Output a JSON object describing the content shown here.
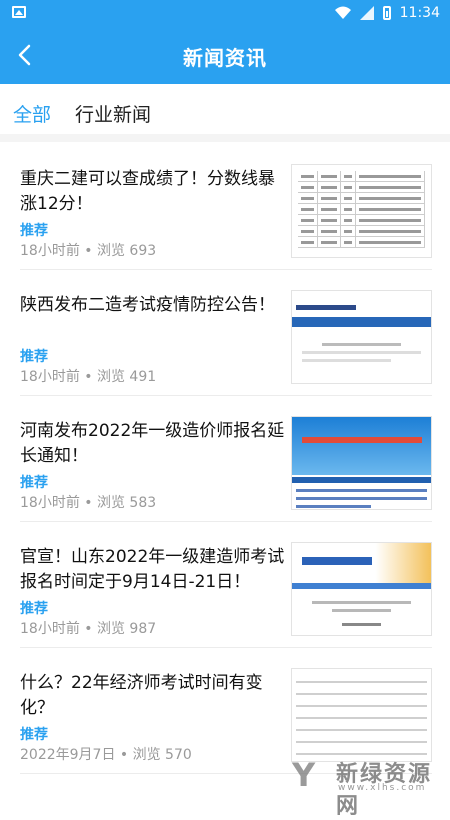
{
  "status_bar": {
    "time": "11:34"
  },
  "header": {
    "title": "新闻资讯"
  },
  "tabs": [
    {
      "label": "全部",
      "active": true
    },
    {
      "label": "行业新闻",
      "active": false
    }
  ],
  "articles": [
    {
      "title": "重庆二建可以查成绩了！分数线暴涨12分！",
      "tag": "推荐",
      "meta": "18小时前 • 浏览 693"
    },
    {
      "title": "陕西发布二造考试疫情防控公告！",
      "tag": "推荐",
      "meta": "18小时前 • 浏览 491"
    },
    {
      "title": "河南发布2022年一级造价师报名延长通知！",
      "tag": "推荐",
      "meta": "18小时前 • 浏览 583"
    },
    {
      "title": "官宣！山东2022年一级建造师考试报名时间定于9月14日-21日！",
      "tag": "推荐",
      "meta": "18小时前 • 浏览 987"
    },
    {
      "title": "什么？22年经济师考试时间有变化？",
      "tag": "推荐",
      "meta": "2022年9月7日 • 浏览 570"
    }
  ],
  "watermark": {
    "brand": "新绿资源网",
    "url": "www.xlhs.com"
  },
  "colors": {
    "primary": "#2aa1f0"
  }
}
